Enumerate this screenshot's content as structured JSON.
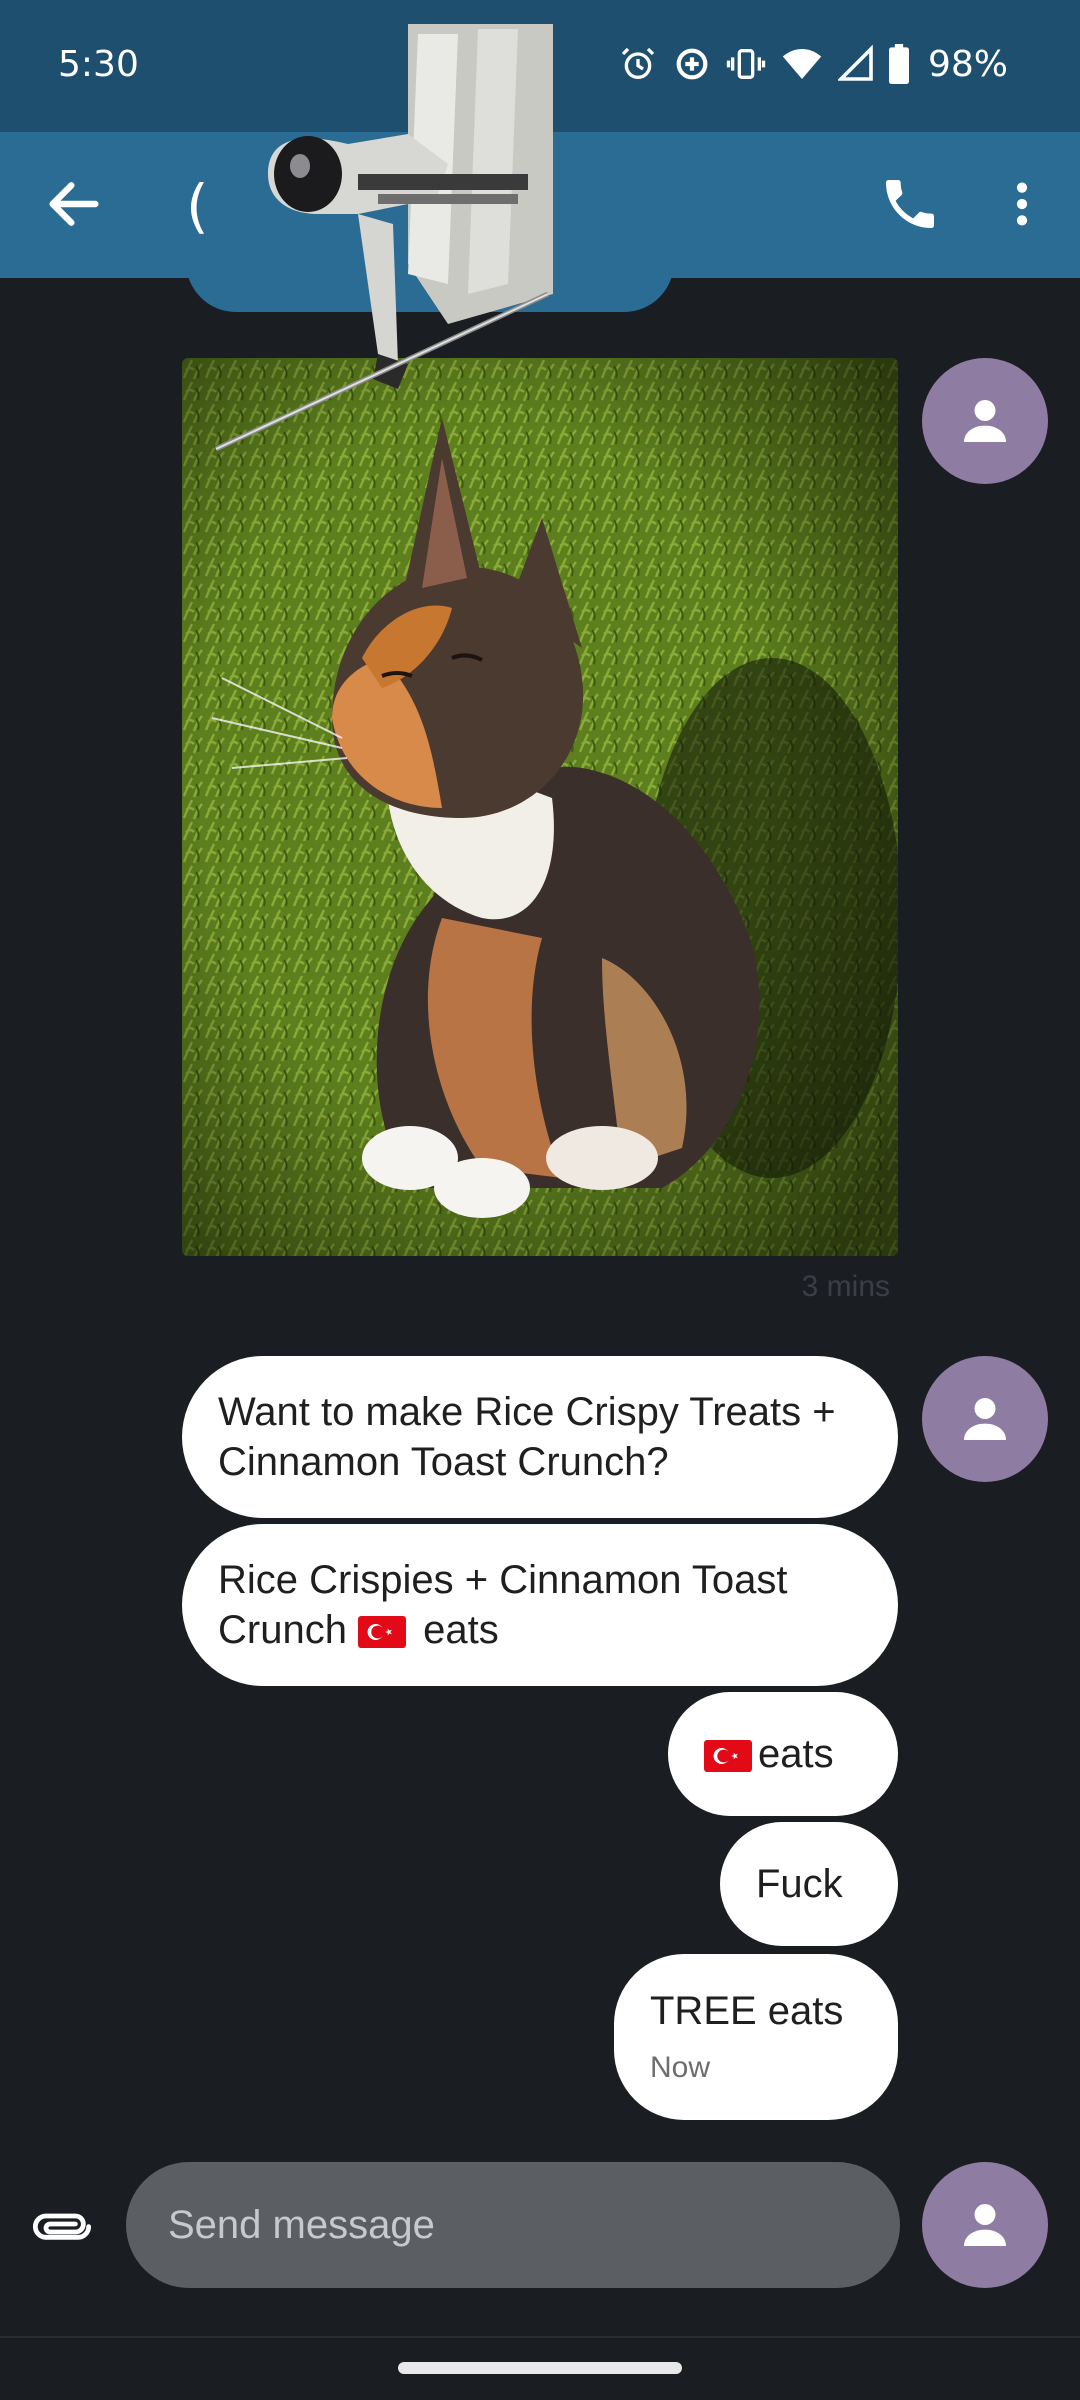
{
  "status_bar": {
    "time": "5:30",
    "battery": "98%",
    "icons": [
      "alarm-icon",
      "data-saver-icon",
      "vibrate-icon",
      "wifi-icon",
      "signal-icon",
      "battery-icon"
    ]
  },
  "app_bar": {
    "title_fragment": "(",
    "back_icon": "arrow-back-icon",
    "call_icon": "phone-icon",
    "menu_icon": "more-vert-icon",
    "color": "#2a6c93"
  },
  "conversation": {
    "photo_caption_time": "3 mins",
    "messages": [
      {
        "line1": "Want to make Rice Crispy Treats +",
        "line2": "Cinnamon Toast Crunch?"
      },
      {
        "line1": "Rice Crispies + Cinnamon Toast",
        "line2_pre": "Crunch ",
        "line2_post": " eats"
      },
      {
        "text": "eats"
      },
      {
        "text": "Fuck"
      },
      {
        "text": "TREE eats",
        "time": "Now"
      }
    ]
  },
  "composer": {
    "placeholder": "Send message",
    "attach_icon": "attachment-icon"
  },
  "colors": {
    "background": "#1a1d21",
    "bubble": "#ffffff",
    "avatar": "#8e7ca3",
    "input": "#5b5e63",
    "flag_red": "#e30a17"
  }
}
